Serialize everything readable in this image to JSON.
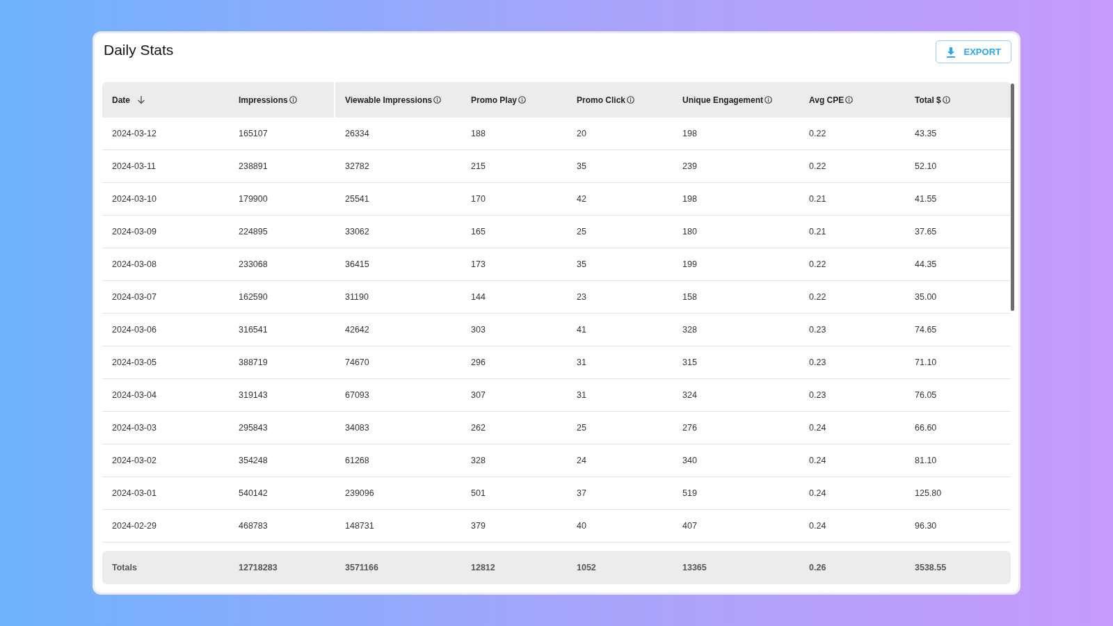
{
  "title": "Daily Stats",
  "export_button": {
    "label": "EXPORT"
  },
  "table": {
    "columns": [
      {
        "label": "Date",
        "sorted": true,
        "info": false
      },
      {
        "label": "Impressions",
        "sorted": false,
        "info": true
      },
      {
        "label": "Viewable Impressions",
        "sorted": false,
        "info": true
      },
      {
        "label": "Promo Play",
        "sorted": false,
        "info": true
      },
      {
        "label": "Promo Click",
        "sorted": false,
        "info": true
      },
      {
        "label": "Unique Engagement",
        "sorted": false,
        "info": true
      },
      {
        "label": "Avg CPE",
        "sorted": false,
        "info": true
      },
      {
        "label": "Total $",
        "sorted": false,
        "info": true
      }
    ],
    "rows": [
      [
        "2024-03-12",
        "165107",
        "26334",
        "188",
        "20",
        "198",
        "0.22",
        "43.35"
      ],
      [
        "2024-03-11",
        "238891",
        "32782",
        "215",
        "35",
        "239",
        "0.22",
        "52.10"
      ],
      [
        "2024-03-10",
        "179900",
        "25541",
        "170",
        "42",
        "198",
        "0.21",
        "41.55"
      ],
      [
        "2024-03-09",
        "224895",
        "33062",
        "165",
        "25",
        "180",
        "0.21",
        "37.65"
      ],
      [
        "2024-03-08",
        "233068",
        "36415",
        "173",
        "35",
        "199",
        "0.22",
        "44.35"
      ],
      [
        "2024-03-07",
        "162590",
        "31190",
        "144",
        "23",
        "158",
        "0.22",
        "35.00"
      ],
      [
        "2024-03-06",
        "316541",
        "42642",
        "303",
        "41",
        "328",
        "0.23",
        "74.65"
      ],
      [
        "2024-03-05",
        "388719",
        "74670",
        "296",
        "31",
        "315",
        "0.23",
        "71.10"
      ],
      [
        "2024-03-04",
        "319143",
        "67093",
        "307",
        "31",
        "324",
        "0.23",
        "76.05"
      ],
      [
        "2024-03-03",
        "295843",
        "34083",
        "262",
        "25",
        "276",
        "0.24",
        "66.60"
      ],
      [
        "2024-03-02",
        "354248",
        "61268",
        "328",
        "24",
        "340",
        "0.24",
        "81.10"
      ],
      [
        "2024-03-01",
        "540142",
        "239096",
        "501",
        "37",
        "519",
        "0.24",
        "125.80"
      ],
      [
        "2024-02-29",
        "468783",
        "148731",
        "379",
        "40",
        "407",
        "0.24",
        "96.30"
      ]
    ],
    "totals": [
      "Totals",
      "12718283",
      "3571166",
      "12812",
      "1052",
      "13365",
      "0.26",
      "3538.55"
    ]
  }
}
